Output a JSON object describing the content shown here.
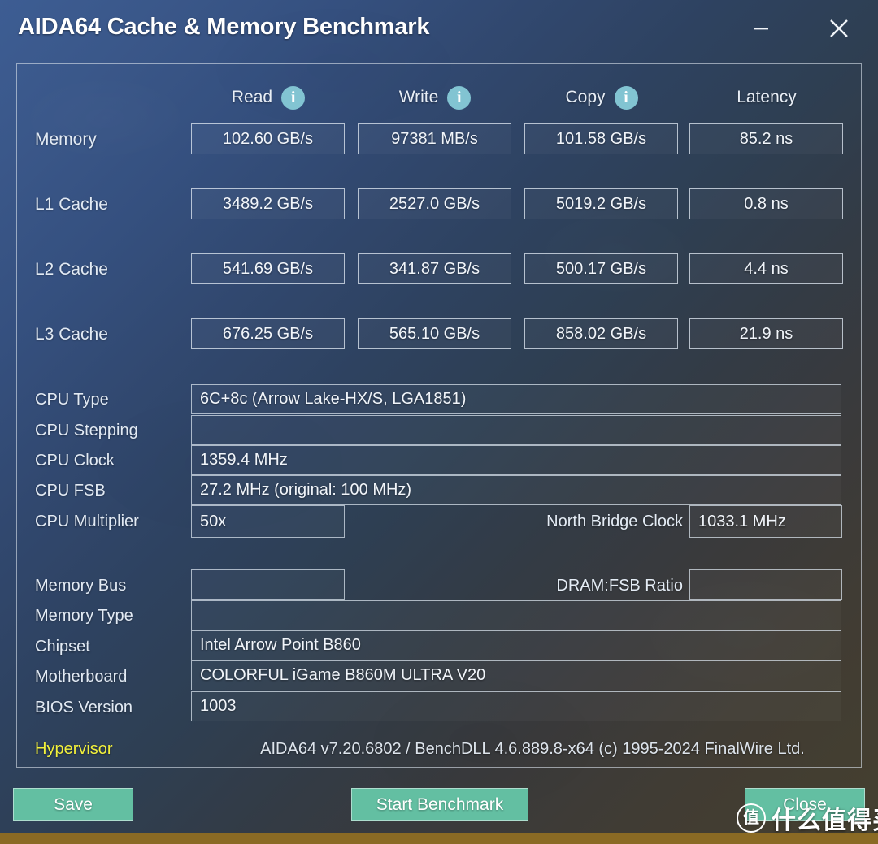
{
  "window": {
    "title": "AIDA64 Cache & Memory Benchmark",
    "minimize_icon": "minimize-icon",
    "close_icon": "close-icon"
  },
  "columns": [
    {
      "label": "Read",
      "info_icon": "info-icon"
    },
    {
      "label": "Write",
      "info_icon": "info-icon"
    },
    {
      "label": "Copy",
      "info_icon": "info-icon"
    },
    {
      "label": "Latency",
      "info_icon": null
    }
  ],
  "benchmark_rows": [
    {
      "label": "Memory",
      "read": "102.60 GB/s",
      "write": "97381 MB/s",
      "copy": "101.58 GB/s",
      "latency": "85.2 ns"
    },
    {
      "label": "L1 Cache",
      "read": "3489.2 GB/s",
      "write": "2527.0 GB/s",
      "copy": "5019.2 GB/s",
      "latency": "0.8 ns"
    },
    {
      "label": "L2 Cache",
      "read": "541.69 GB/s",
      "write": "341.87 GB/s",
      "copy": "500.17 GB/s",
      "latency": "4.4 ns"
    },
    {
      "label": "L3 Cache",
      "read": "676.25 GB/s",
      "write": "565.10 GB/s",
      "copy": "858.02 GB/s",
      "latency": "21.9 ns"
    }
  ],
  "cpu_info": {
    "type_label": "CPU Type",
    "type_value": "6C+8c   (Arrow Lake-HX/S, LGA1851)",
    "stepping_label": "CPU Stepping",
    "stepping_value": "",
    "clock_label": "CPU Clock",
    "clock_value": "1359.4 MHz",
    "fsb_label": "CPU FSB",
    "fsb_value": "27.2 MHz  (original: 100 MHz)",
    "multiplier_label": "CPU Multiplier",
    "multiplier_value": "50x",
    "north_bridge_label": "North Bridge Clock",
    "north_bridge_value": "1033.1 MHz"
  },
  "memory_info": {
    "bus_label": "Memory Bus",
    "bus_value": "",
    "dram_fsb_label": "DRAM:FSB Ratio",
    "dram_fsb_value": "",
    "type_label": "Memory Type",
    "type_value": "",
    "chipset_label": "Chipset",
    "chipset_value": "Intel Arrow Point B860",
    "motherboard_label": "Motherboard",
    "motherboard_value": "COLORFUL iGame B860M ULTRA V20",
    "bios_label": "BIOS Version",
    "bios_value": "1003"
  },
  "footer": {
    "hypervisor_label": "Hypervisor",
    "version_text": "AIDA64 v7.20.6802 / BenchDLL 4.6.889.8-x64  (c) 1995-2024 FinalWire Ltd."
  },
  "buttons": {
    "save": "Save",
    "start_benchmark": "Start Benchmark",
    "close": "Close"
  },
  "watermark": {
    "badge": "值",
    "text": "什么值得买"
  },
  "colors": {
    "accent_button": "#63bfa2",
    "info_icon": "#82c4d2",
    "hypervisor_text": "#f2f03c",
    "bottom_strip": "#8a6a24",
    "bg_top_left": "#3d5d93",
    "bg_bottom_right": "#45402f"
  }
}
